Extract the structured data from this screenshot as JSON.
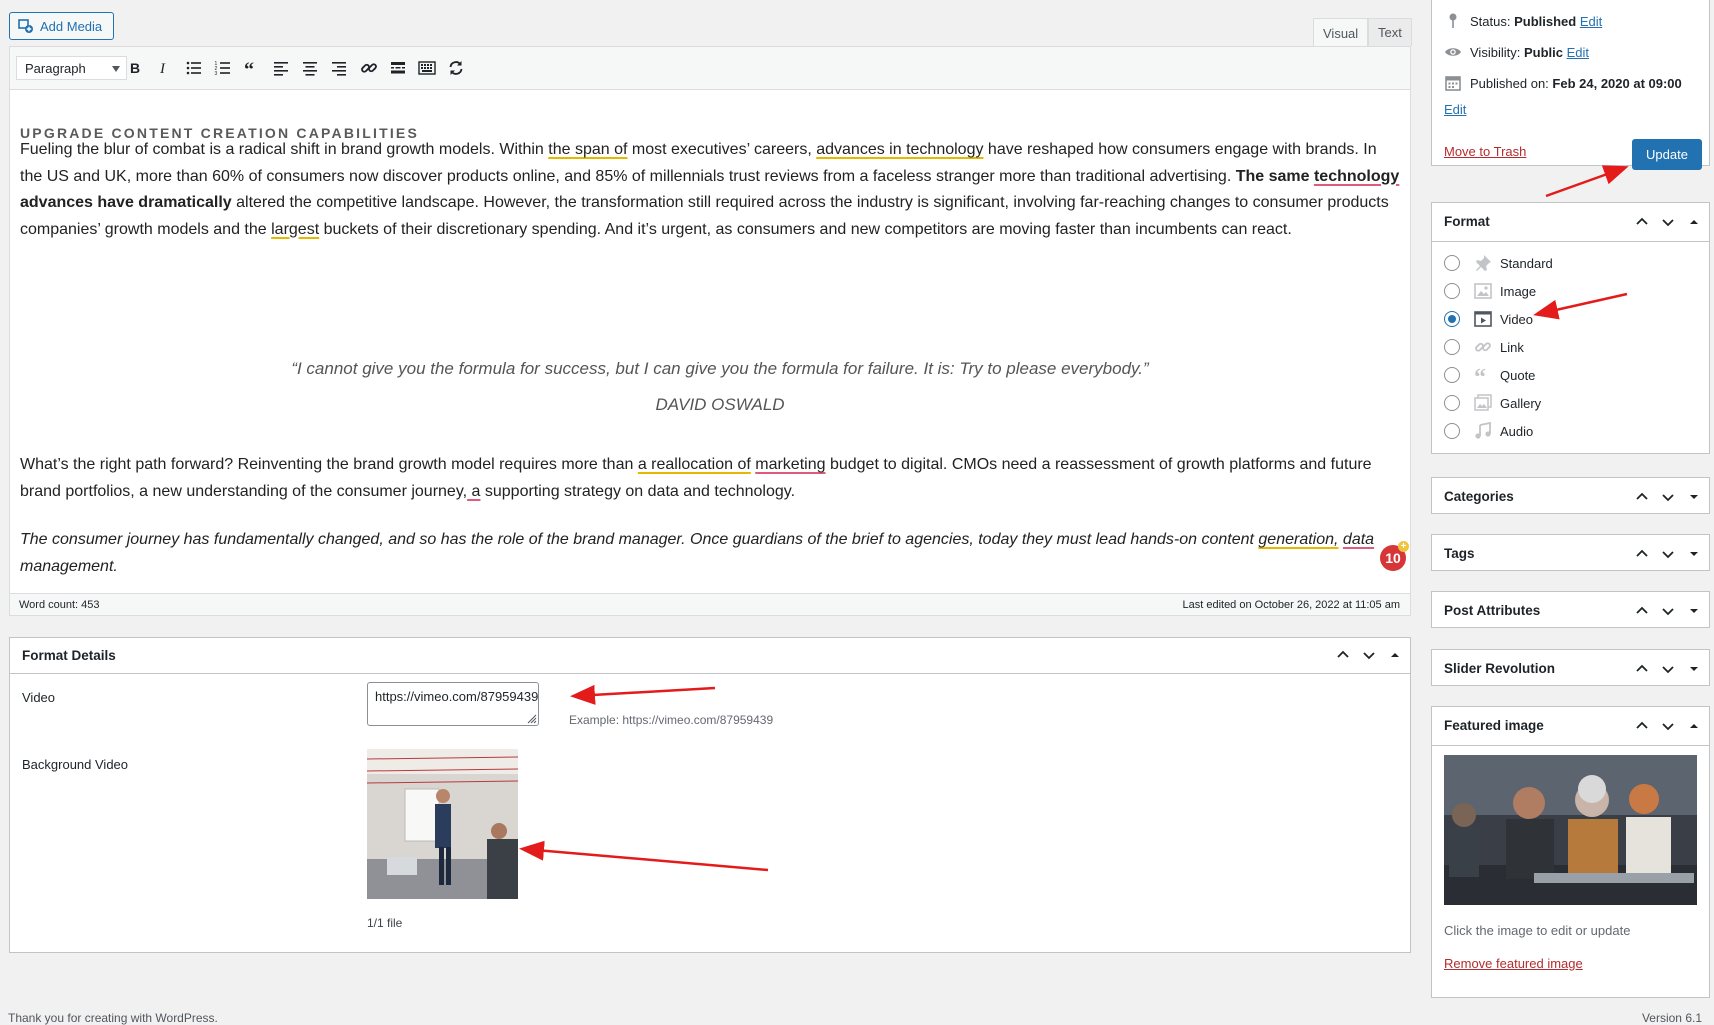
{
  "editor": {
    "add_media_label": "Add Media",
    "tabs": {
      "visual": "Visual",
      "text": "Text"
    },
    "paragraph_select": "Paragraph",
    "toolbar_icons": [
      "bold-icon",
      "italic-icon",
      "bulleted-list-icon",
      "numbered-list-icon",
      "blockquote-icon",
      "align-left-icon",
      "align-center-icon",
      "align-right-icon",
      "link-icon",
      "read-more-icon",
      "toolbar-toggle-icon",
      "refresh-icon"
    ],
    "heading": "UPGRADE CONTENT CREATION CAPABILITIES",
    "p1": {
      "a": "Fueling the blur of combat is a radical shift in brand growth models. Within ",
      "u1": "the span of",
      "b": " most executives’ careers, ",
      "u2": "advances in technology",
      "c": " have reshaped how consumers engage with brands. In the US and UK, more than 60% of consumers now discover products online, and 85% of millennials trust reviews from a faceless stranger more than traditional advertising. ",
      "bold1": "The same ",
      "bold_u": "technology",
      "bold2": " advances have dramatically",
      "d": " altered the competitive landscape. However, the transformation still required across the industry is significant, involving far-reaching changes to consumer products companies’ growth models and the ",
      "u3": "largest",
      "e": " buckets of their discretionary spending. And it’s urgent, as consumers and new competitors are moving faster than incumbents can react."
    },
    "quote": "“I cannot give you the formula for success, but I can give you the formula for failure. It is: Try to please everybody.”",
    "quote_author": "DAVID OSWALD",
    "p2": {
      "a": "What’s the right path forward? Reinventing the brand growth model requires more than ",
      "u1": "a reallocation of",
      "sp": " ",
      "u2": "marketing",
      "b": " budget to digital. CMOs need a reassessment of growth platforms and future brand portfolios, a new understanding of the consumer journey,",
      "u3": " a",
      "c": " supporting strategy on data and technology."
    },
    "p3": {
      "a": "The consumer journey has fundamentally changed, and so has the role of the brand manager. Once guardians of the brief to agencies, today they must lead hands-on content ",
      "u1": "generation,",
      "sp": " ",
      "u2": "data",
      "b": " management."
    },
    "badge": "10",
    "word_count": "Word count: 453",
    "last_edited": "Last edited on October 26, 2022 at 11:05 am"
  },
  "format_details": {
    "title": "Format Details",
    "video_label": "Video",
    "video_value": "https://vimeo.com/87959439",
    "example": "Example: https://vimeo.com/87959439",
    "bg_video_label": "Background Video",
    "file_count": "1/1 file"
  },
  "publish": {
    "status_label": "Status:",
    "status_value": "Published",
    "visibility_label": "Visibility:",
    "visibility_value": "Public",
    "published_label": "Published on:",
    "published_value": "Feb 24, 2020 at 09:00",
    "edit": "Edit",
    "trash": "Move to Trash",
    "update": "Update"
  },
  "format_box": {
    "title": "Format",
    "selected": "Video",
    "options": [
      "Standard",
      "Image",
      "Video",
      "Link",
      "Quote",
      "Gallery",
      "Audio"
    ]
  },
  "boxes": {
    "categories": "Categories",
    "tags": "Tags",
    "post_attributes": "Post Attributes",
    "slider_revolution": "Slider Revolution",
    "featured_image": "Featured image",
    "featured_help": "Click the image to edit or update",
    "featured_remove": "Remove featured image"
  },
  "footer": {
    "left": "Thank you for creating with WordPress.",
    "right": "Version 6.1"
  },
  "colors": {
    "accent": "#2271b1",
    "danger": "#b32d2e",
    "annotation": "#e31b1b"
  }
}
